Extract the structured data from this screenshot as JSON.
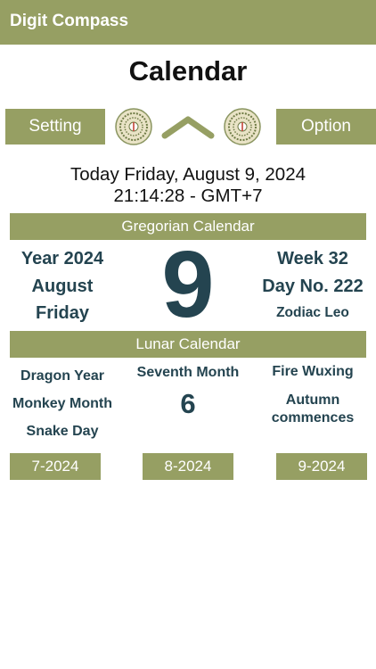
{
  "app": {
    "title": "Digit Compass"
  },
  "page": {
    "title": "Calendar"
  },
  "toolbar": {
    "setting_label": "Setting",
    "option_label": "Option"
  },
  "today": {
    "line": "Today Friday, August 9, 2024",
    "time": "21:14:28 - GMT+7"
  },
  "gregorian": {
    "header": "Gregorian Calendar",
    "year": "Year 2024",
    "month": "August",
    "weekday": "Friday",
    "day": "9",
    "week": "Week 32",
    "day_no": "Day No. 222",
    "zodiac": "Zodiac Leo"
  },
  "lunar": {
    "header": "Lunar Calendar",
    "year": "Dragon Year",
    "month_animal": "Monkey Month",
    "day_animal": "Snake Day",
    "month_name": "Seventh Month",
    "day": "6",
    "wuxing": "Fire Wuxing",
    "solar_term": "Autumn commences"
  },
  "nav": {
    "prev": "7-2024",
    "current": "8-2024",
    "next": "9-2024"
  },
  "colors": {
    "accent": "#969f63",
    "text_dark": "#244450"
  },
  "icons": [
    "compass-icon",
    "chevron-up-icon"
  ]
}
